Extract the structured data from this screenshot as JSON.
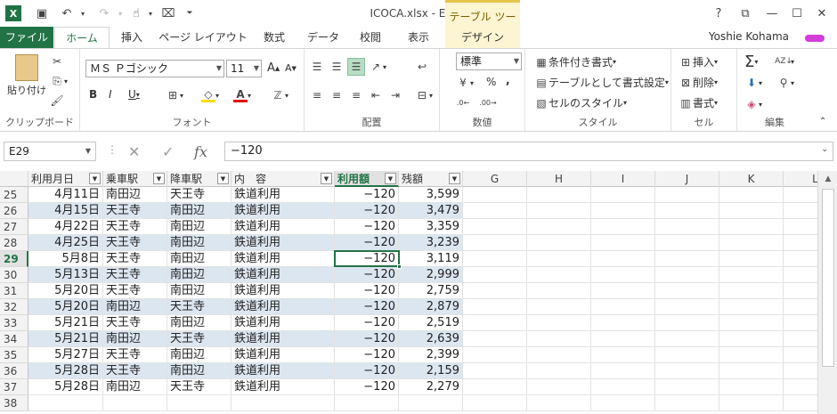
{
  "window": {
    "title": "ICOCA.xlsx - Excel",
    "context_tab_group": "テーブル ツール",
    "help_label": "?",
    "controls": [
      "ribbon-display",
      "minimize",
      "maximize",
      "close"
    ]
  },
  "tabs": [
    "ファイル",
    "ホーム",
    "挿入",
    "ページ レイアウト",
    "数式",
    "データ",
    "校閲",
    "表示",
    "デザイン"
  ],
  "active_tab": "ホーム",
  "user": {
    "name": "Yoshie Kohama"
  },
  "ribbon": {
    "clipboard": {
      "label": "クリップボード",
      "paste": "貼り付け"
    },
    "font": {
      "label": "フォント",
      "name": "ＭＳ Ｐゴシック",
      "size": "11"
    },
    "alignment": {
      "label": "配置"
    },
    "number": {
      "label": "数値",
      "format": "標準",
      "percent": "%",
      "comma": ","
    },
    "styles": {
      "label": "スタイル",
      "conditional": "条件付き書式",
      "as_table": "テーブルとして書式設定",
      "cell_styles": "セルのスタイル"
    },
    "cells": {
      "label": "セル",
      "insert": "挿入",
      "delete": "削除",
      "format": "書式"
    },
    "editing": {
      "label": "編集"
    }
  },
  "formula_bar": {
    "name_box": "E29",
    "fx": "fx",
    "content": "−120"
  },
  "columns": {
    "headers": [
      "利用月日",
      "乗車駅",
      "降車駅",
      "内　容",
      "利用額",
      "残額"
    ],
    "letters": [
      "G",
      "H",
      "I",
      "J",
      "K",
      "L"
    ],
    "active": "利用額"
  },
  "active_row": "29",
  "rows": [
    {
      "n": "25",
      "date": "4月11日",
      "from": "南田辺",
      "to": "天王寺",
      "desc": "鉄道利用",
      "amt": "−120",
      "bal": "3,599"
    },
    {
      "n": "26",
      "date": "4月15日",
      "from": "天王寺",
      "to": "南田辺",
      "desc": "鉄道利用",
      "amt": "−120",
      "bal": "3,479"
    },
    {
      "n": "27",
      "date": "4月22日",
      "from": "天王寺",
      "to": "南田辺",
      "desc": "鉄道利用",
      "amt": "−120",
      "bal": "3,359"
    },
    {
      "n": "28",
      "date": "4月25日",
      "from": "天王寺",
      "to": "南田辺",
      "desc": "鉄道利用",
      "amt": "−120",
      "bal": "3,239"
    },
    {
      "n": "29",
      "date": "5月8日",
      "from": "天王寺",
      "to": "南田辺",
      "desc": "鉄道利用",
      "amt": "−120",
      "bal": "3,119"
    },
    {
      "n": "30",
      "date": "5月13日",
      "from": "天王寺",
      "to": "南田辺",
      "desc": "鉄道利用",
      "amt": "−120",
      "bal": "2,999"
    },
    {
      "n": "31",
      "date": "5月20日",
      "from": "天王寺",
      "to": "南田辺",
      "desc": "鉄道利用",
      "amt": "−120",
      "bal": "2,759"
    },
    {
      "n": "32",
      "date": "5月20日",
      "from": "南田辺",
      "to": "天王寺",
      "desc": "鉄道利用",
      "amt": "−120",
      "bal": "2,879"
    },
    {
      "n": "33",
      "date": "5月21日",
      "from": "天王寺",
      "to": "南田辺",
      "desc": "鉄道利用",
      "amt": "−120",
      "bal": "2,519"
    },
    {
      "n": "34",
      "date": "5月21日",
      "from": "南田辺",
      "to": "天王寺",
      "desc": "鉄道利用",
      "amt": "−120",
      "bal": "2,639"
    },
    {
      "n": "35",
      "date": "5月27日",
      "from": "天王寺",
      "to": "南田辺",
      "desc": "鉄道利用",
      "amt": "−120",
      "bal": "2,399"
    },
    {
      "n": "36",
      "date": "5月28日",
      "from": "天王寺",
      "to": "南田辺",
      "desc": "鉄道利用",
      "amt": "−120",
      "bal": "2,159"
    },
    {
      "n": "37",
      "date": "5月28日",
      "from": "南田辺",
      "to": "天王寺",
      "desc": "鉄道利用",
      "amt": "−120",
      "bal": "2,279"
    },
    {
      "n": "38",
      "date": "",
      "from": "",
      "to": "",
      "desc": "",
      "amt": "",
      "bal": ""
    }
  ],
  "colors": {
    "excel_green": "#217346",
    "table_band": "#dce6f1",
    "context_tab": "#fdf5d1"
  }
}
